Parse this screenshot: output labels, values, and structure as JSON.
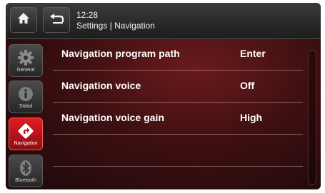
{
  "header": {
    "time": "12:28",
    "title": "Settings | Navigation"
  },
  "sidebar": {
    "items": [
      {
        "label": "General",
        "icon": "gear-icon"
      },
      {
        "label": "Stdod",
        "icon": "info-icon"
      },
      {
        "label": "Navigation",
        "icon": "navigation-arrow-icon"
      },
      {
        "label": "Bluetooth",
        "icon": "bluetooth-icon"
      }
    ]
  },
  "settings": {
    "rows": [
      {
        "name": "Navigation program path",
        "value": "Enter"
      },
      {
        "name": "Navigation voice",
        "value": "Off"
      },
      {
        "name": "Navigation voice gain",
        "value": "High"
      },
      {
        "name": "",
        "value": ""
      }
    ]
  },
  "colors": {
    "accent": "#e31d24",
    "background": "#3f0e10"
  }
}
